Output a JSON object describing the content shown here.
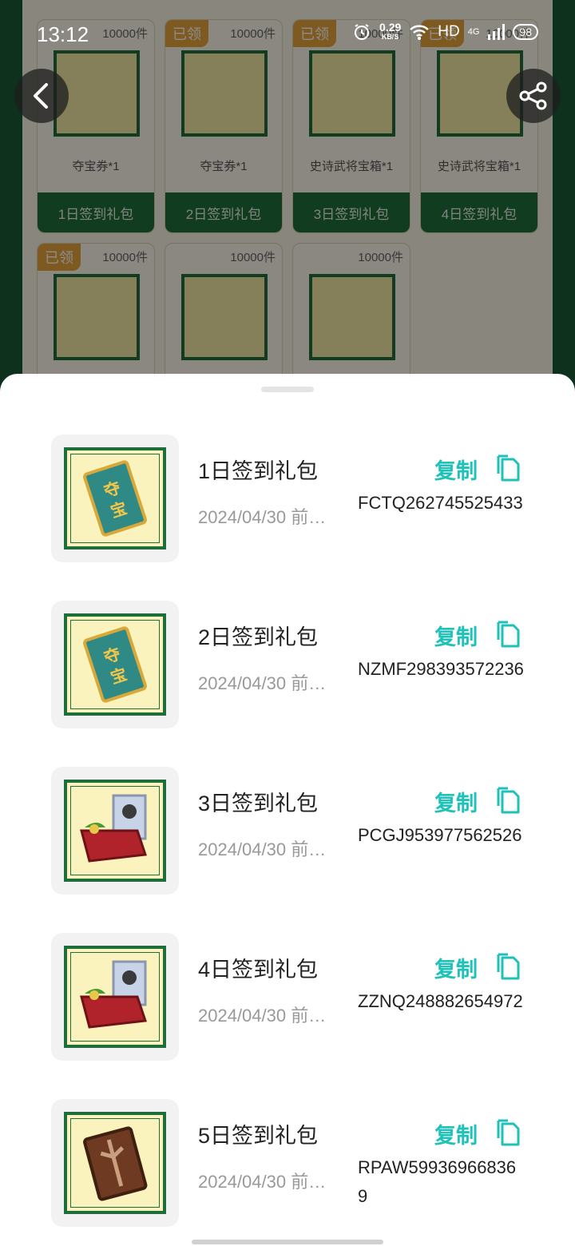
{
  "status_bar": {
    "time": "13:12",
    "speed": "0.29",
    "speed_unit": "KB/S",
    "hd": "HD",
    "network": "4G",
    "battery": "98"
  },
  "background": {
    "cards": [
      {
        "tag": "",
        "stock": "10000件",
        "item": "夺宝券*1",
        "button": "1日签到礼包"
      },
      {
        "tag": "已领",
        "stock": "10000件",
        "item": "夺宝券*1",
        "button": "2日签到礼包"
      },
      {
        "tag": "已领",
        "stock": "10000件",
        "item": "史诗武将宝箱*1",
        "button": "3日签到礼包"
      },
      {
        "tag": "已领",
        "stock": "10000件",
        "item": "史诗武将宝箱*1",
        "button": "4日签到礼包"
      },
      {
        "tag": "已领",
        "stock": "10000件",
        "item": "",
        "button": ""
      },
      {
        "tag": "",
        "stock": "10000件",
        "item": "",
        "button": ""
      },
      {
        "tag": "",
        "stock": "10000件",
        "item": "",
        "button": ""
      }
    ]
  },
  "sheet": {
    "copy_label": "复制",
    "items": [
      {
        "title": "1日签到礼包",
        "date": "2024/04/30 前…",
        "code": "FCTQ262745525433",
        "icon": "ticket-icon"
      },
      {
        "title": "2日签到礼包",
        "date": "2024/04/30 前…",
        "code": "NZMF298393572236",
        "icon": "ticket-icon"
      },
      {
        "title": "3日签到礼包",
        "date": "2024/04/30 前…",
        "code": "PCGJ953977562526",
        "icon": "chest-icon"
      },
      {
        "title": "4日签到礼包",
        "date": "2024/04/30 前…",
        "code": "ZZNQ248882654972",
        "icon": "chest-icon"
      },
      {
        "title": "5日签到礼包",
        "date": "2024/04/30 前…",
        "code": "RPAW599369668369",
        "icon": "book-icon"
      }
    ]
  },
  "colors": {
    "accent": "#1ec2b8",
    "green": "#1f6d3a",
    "tag": "#e6a43c"
  }
}
